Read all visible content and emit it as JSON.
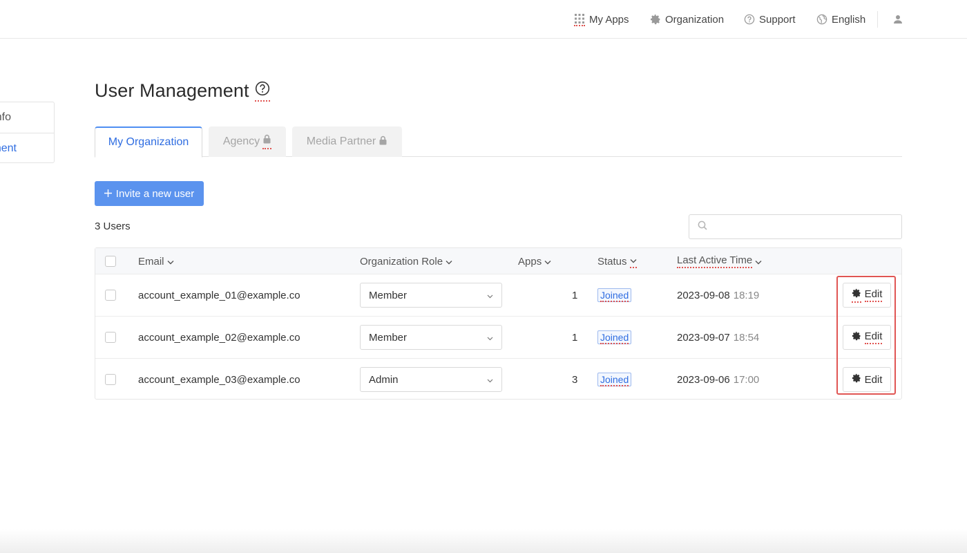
{
  "topbar": {
    "my_apps": "My Apps",
    "organization": "Organization",
    "support": "Support",
    "language": "English"
  },
  "sidebar": {
    "items": [
      {
        "label": "nfo"
      },
      {
        "label": "nent"
      }
    ]
  },
  "page": {
    "title": "User Management"
  },
  "tabs": [
    {
      "label": "My Organization",
      "active": true
    },
    {
      "label": "Agency",
      "locked": true
    },
    {
      "label": "Media Partner",
      "locked": true
    }
  ],
  "toolbar": {
    "invite_label": "Invite a new user",
    "user_count": "3 Users",
    "search_placeholder": ""
  },
  "table": {
    "columns": {
      "email": "Email",
      "role": "Organization Role",
      "apps": "Apps",
      "status": "Status",
      "last_active": "Last Active Time"
    },
    "rows": [
      {
        "email": "account_example_01@example.co",
        "role": "Member",
        "apps": "1",
        "status": "Joined",
        "date": "2023-09-08",
        "time": "18:19",
        "edit": "Edit"
      },
      {
        "email": "account_example_02@example.co",
        "role": "Member",
        "apps": "1",
        "status": "Joined",
        "date": "2023-09-07",
        "time": "18:54",
        "edit": "Edit"
      },
      {
        "email": "account_example_03@example.co",
        "role": "Admin",
        "apps": "3",
        "status": "Joined",
        "date": "2023-09-06",
        "time": "17:00",
        "edit": "Edit"
      }
    ]
  },
  "colors": {
    "accent": "#2f6de1",
    "primary_button": "#5b93ee",
    "highlight_box": "#e05553"
  }
}
